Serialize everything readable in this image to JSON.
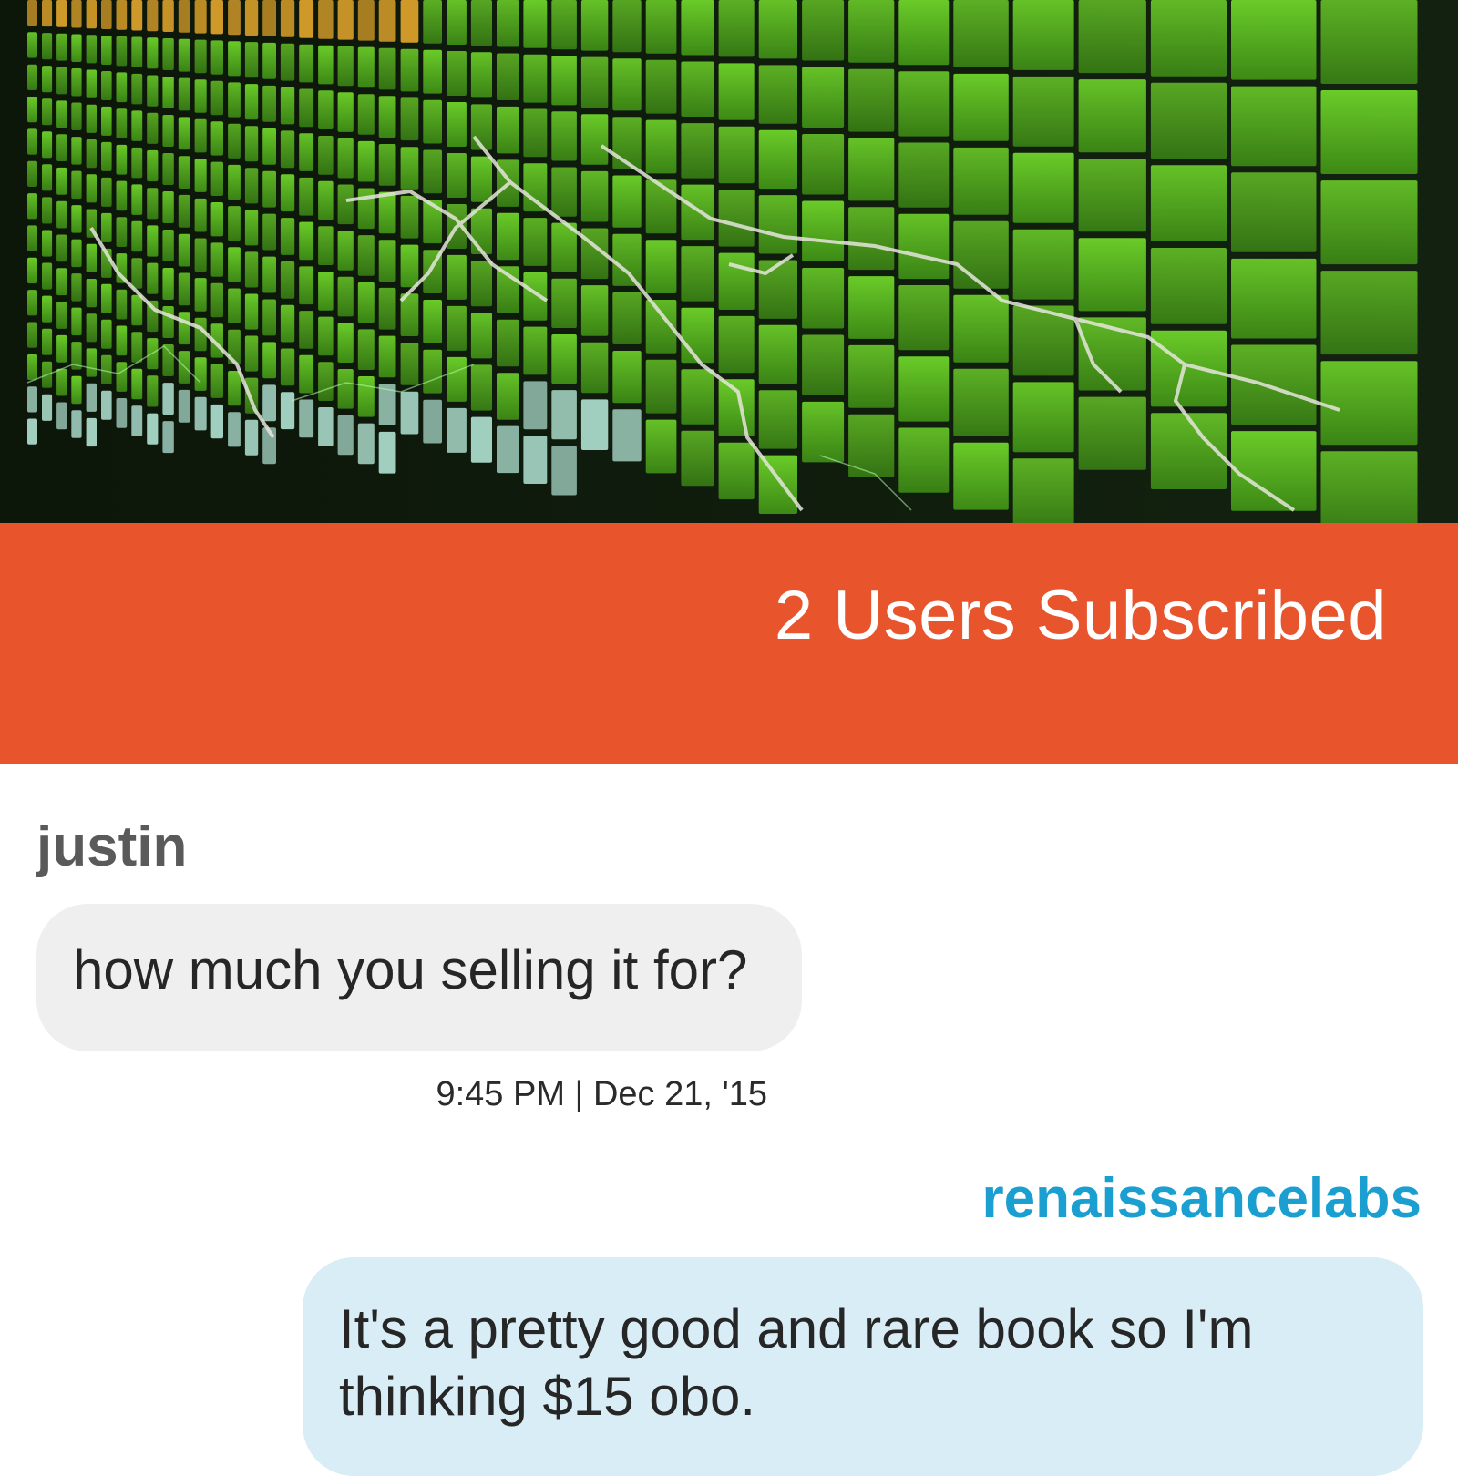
{
  "header": {
    "subscribers_label": "2 Users Subscribed",
    "accent_color": "#e8552d"
  },
  "messages": [
    {
      "author": "justin",
      "text": "how much you selling it for?",
      "timestamp": "9:45 PM | Dec 21, '15",
      "side": "left"
    },
    {
      "author": "renaissancelabs",
      "text": "It's a pretty good and rare book so I'm thinking $15 obo.",
      "side": "right",
      "author_color": "#1a9fd0"
    }
  ]
}
